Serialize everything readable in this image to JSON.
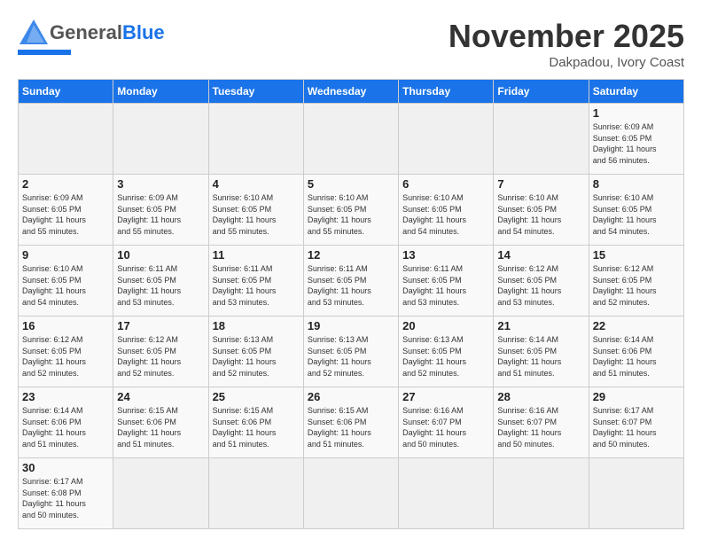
{
  "header": {
    "logo_general": "General",
    "logo_blue": "Blue",
    "month_title": "November 2025",
    "location": "Dakpadou, Ivory Coast"
  },
  "weekdays": [
    "Sunday",
    "Monday",
    "Tuesday",
    "Wednesday",
    "Thursday",
    "Friday",
    "Saturday"
  ],
  "weeks": [
    [
      {
        "day": "",
        "info": ""
      },
      {
        "day": "",
        "info": ""
      },
      {
        "day": "",
        "info": ""
      },
      {
        "day": "",
        "info": ""
      },
      {
        "day": "",
        "info": ""
      },
      {
        "day": "",
        "info": ""
      },
      {
        "day": "1",
        "info": "Sunrise: 6:09 AM\nSunset: 6:05 PM\nDaylight: 11 hours\nand 56 minutes."
      }
    ],
    [
      {
        "day": "2",
        "info": "Sunrise: 6:09 AM\nSunset: 6:05 PM\nDaylight: 11 hours\nand 55 minutes."
      },
      {
        "day": "3",
        "info": "Sunrise: 6:09 AM\nSunset: 6:05 PM\nDaylight: 11 hours\nand 55 minutes."
      },
      {
        "day": "4",
        "info": "Sunrise: 6:10 AM\nSunset: 6:05 PM\nDaylight: 11 hours\nand 55 minutes."
      },
      {
        "day": "5",
        "info": "Sunrise: 6:10 AM\nSunset: 6:05 PM\nDaylight: 11 hours\nand 55 minutes."
      },
      {
        "day": "6",
        "info": "Sunrise: 6:10 AM\nSunset: 6:05 PM\nDaylight: 11 hours\nand 54 minutes."
      },
      {
        "day": "7",
        "info": "Sunrise: 6:10 AM\nSunset: 6:05 PM\nDaylight: 11 hours\nand 54 minutes."
      },
      {
        "day": "8",
        "info": "Sunrise: 6:10 AM\nSunset: 6:05 PM\nDaylight: 11 hours\nand 54 minutes."
      }
    ],
    [
      {
        "day": "9",
        "info": "Sunrise: 6:10 AM\nSunset: 6:05 PM\nDaylight: 11 hours\nand 54 minutes."
      },
      {
        "day": "10",
        "info": "Sunrise: 6:11 AM\nSunset: 6:05 PM\nDaylight: 11 hours\nand 53 minutes."
      },
      {
        "day": "11",
        "info": "Sunrise: 6:11 AM\nSunset: 6:05 PM\nDaylight: 11 hours\nand 53 minutes."
      },
      {
        "day": "12",
        "info": "Sunrise: 6:11 AM\nSunset: 6:05 PM\nDaylight: 11 hours\nand 53 minutes."
      },
      {
        "day": "13",
        "info": "Sunrise: 6:11 AM\nSunset: 6:05 PM\nDaylight: 11 hours\nand 53 minutes."
      },
      {
        "day": "14",
        "info": "Sunrise: 6:12 AM\nSunset: 6:05 PM\nDaylight: 11 hours\nand 53 minutes."
      },
      {
        "day": "15",
        "info": "Sunrise: 6:12 AM\nSunset: 6:05 PM\nDaylight: 11 hours\nand 52 minutes."
      }
    ],
    [
      {
        "day": "16",
        "info": "Sunrise: 6:12 AM\nSunset: 6:05 PM\nDaylight: 11 hours\nand 52 minutes."
      },
      {
        "day": "17",
        "info": "Sunrise: 6:12 AM\nSunset: 6:05 PM\nDaylight: 11 hours\nand 52 minutes."
      },
      {
        "day": "18",
        "info": "Sunrise: 6:13 AM\nSunset: 6:05 PM\nDaylight: 11 hours\nand 52 minutes."
      },
      {
        "day": "19",
        "info": "Sunrise: 6:13 AM\nSunset: 6:05 PM\nDaylight: 11 hours\nand 52 minutes."
      },
      {
        "day": "20",
        "info": "Sunrise: 6:13 AM\nSunset: 6:05 PM\nDaylight: 11 hours\nand 52 minutes."
      },
      {
        "day": "21",
        "info": "Sunrise: 6:14 AM\nSunset: 6:05 PM\nDaylight: 11 hours\nand 51 minutes."
      },
      {
        "day": "22",
        "info": "Sunrise: 6:14 AM\nSunset: 6:06 PM\nDaylight: 11 hours\nand 51 minutes."
      }
    ],
    [
      {
        "day": "23",
        "info": "Sunrise: 6:14 AM\nSunset: 6:06 PM\nDaylight: 11 hours\nand 51 minutes."
      },
      {
        "day": "24",
        "info": "Sunrise: 6:15 AM\nSunset: 6:06 PM\nDaylight: 11 hours\nand 51 minutes."
      },
      {
        "day": "25",
        "info": "Sunrise: 6:15 AM\nSunset: 6:06 PM\nDaylight: 11 hours\nand 51 minutes."
      },
      {
        "day": "26",
        "info": "Sunrise: 6:15 AM\nSunset: 6:06 PM\nDaylight: 11 hours\nand 51 minutes."
      },
      {
        "day": "27",
        "info": "Sunrise: 6:16 AM\nSunset: 6:07 PM\nDaylight: 11 hours\nand 50 minutes."
      },
      {
        "day": "28",
        "info": "Sunrise: 6:16 AM\nSunset: 6:07 PM\nDaylight: 11 hours\nand 50 minutes."
      },
      {
        "day": "29",
        "info": "Sunrise: 6:17 AM\nSunset: 6:07 PM\nDaylight: 11 hours\nand 50 minutes."
      }
    ],
    [
      {
        "day": "30",
        "info": "Sunrise: 6:17 AM\nSunset: 6:08 PM\nDaylight: 11 hours\nand 50 minutes."
      },
      {
        "day": "",
        "info": ""
      },
      {
        "day": "",
        "info": ""
      },
      {
        "day": "",
        "info": ""
      },
      {
        "day": "",
        "info": ""
      },
      {
        "day": "",
        "info": ""
      },
      {
        "day": "",
        "info": ""
      }
    ]
  ]
}
